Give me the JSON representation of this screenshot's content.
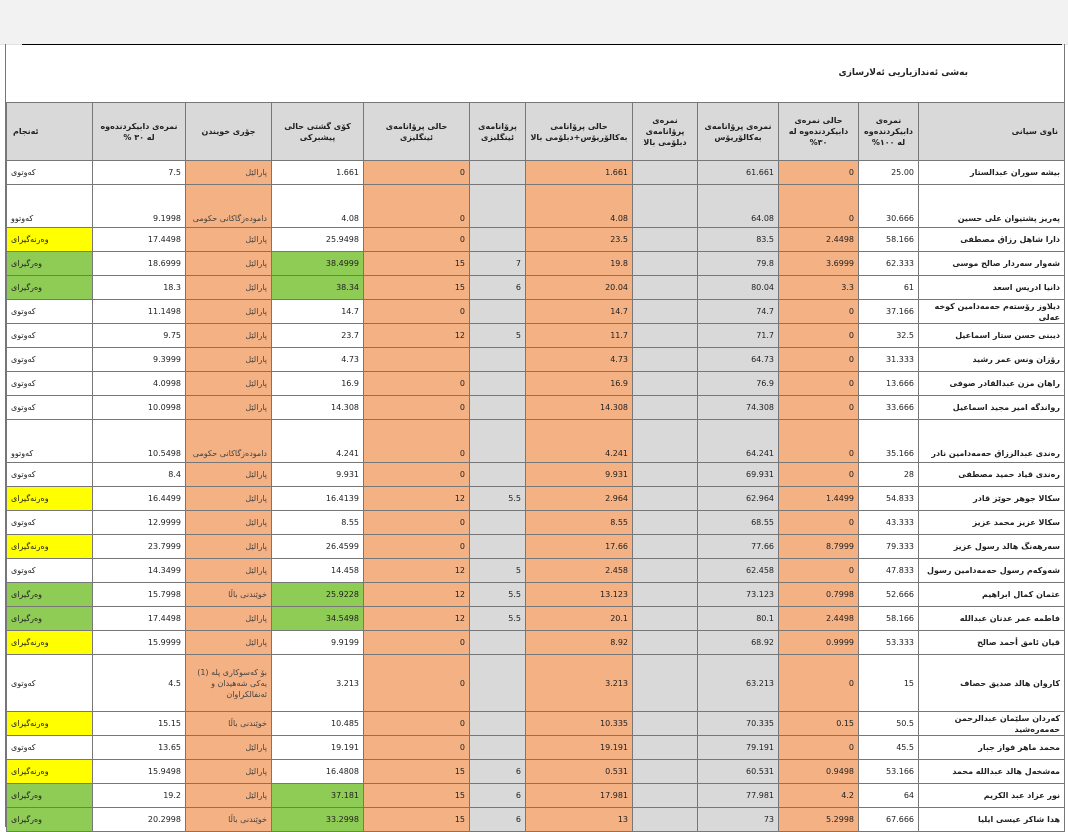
{
  "sheet": {
    "title": "بەشی ئەندازیاریی ئەلارسازی"
  },
  "table": {
    "headers": [
      "ناوی سیانی",
      "نمرەی دابیکردندەوە لە ١٠٠%",
      "حالى نمرەی دابیکردندەوە لە ٣٠%",
      "نمرەی پرۆانامەی بەکالۆریۆس",
      "نمرەی پرۆانامەی دبلۆمی بالا",
      "حالى پرۆانامى بەکالۆریۆس+دبلۆمی بالا",
      "پرۆانامەی ئینگلیزی",
      "حالى پرۆانامەی ئینگلیزی",
      "کۆی گشتی حالی پیشبرکی",
      "جۆری خویندن",
      "نمرەی دابیکردندەوە لە ٣٠ %",
      "ئەنجام"
    ],
    "rows": [
      {
        "name": "بیشە سوران عبدالستار",
        "score100": "25.00",
        "hali30": "0",
        "bach": "61.661",
        "diploma": "",
        "combined": "1.661",
        "english": "",
        "engHali": "0",
        "total": "1.661",
        "type": "پارالێل",
        "score30": "7.5",
        "result": "کەوتوی",
        "h": 23,
        "bottom": false,
        "f": {
          "hali30": "o",
          "combined": "o",
          "engHali": "o",
          "type": "o",
          "total": "",
          "result": ""
        }
      },
      {
        "name": "پەریز پشتیوان علی حسین",
        "score100": "30.666",
        "hali30": "0",
        "bach": "64.08",
        "diploma": "",
        "combined": "4.08",
        "english": "",
        "engHali": "0",
        "total": "4.08",
        "type": "دامودەزگاکانی حکومی",
        "score30": "9.1998",
        "result": "کەوتوو",
        "h": 39,
        "bottom": true,
        "f": {
          "hali30": "o",
          "combined": "o",
          "engHali": "o",
          "type": "o",
          "total": "",
          "result": ""
        }
      },
      {
        "name": "دارا شاهل رزاق مصطفی",
        "score100": "58.166",
        "hali30": "2.4498",
        "bach": "83.5",
        "diploma": "",
        "combined": "23.5",
        "english": "",
        "engHali": "0",
        "total": "25.9498",
        "type": "پارالێل",
        "score30": "17.4498",
        "result": "وەرنەگیرای",
        "h": 23,
        "bottom": false,
        "f": {
          "hali30": "o",
          "combined": "o",
          "engHali": "o",
          "type": "o",
          "total": "",
          "result": "y"
        }
      },
      {
        "name": "شەوار سەردار صالح موسی",
        "score100": "62.333",
        "hali30": "3.6999",
        "bach": "79.8",
        "diploma": "",
        "combined": "19.8",
        "english": "7",
        "engHali": "15",
        "total": "38.4999",
        "type": "پارالێل",
        "score30": "18.6999",
        "result": "وەرگیرای",
        "h": 23,
        "bottom": false,
        "f": {
          "hali30": "o",
          "combined": "o",
          "engHali": "o",
          "type": "o",
          "total": "g",
          "result": "g"
        }
      },
      {
        "name": "دانیا ادریس اسعد",
        "score100": "61",
        "hali30": "3.3",
        "bach": "80.04",
        "diploma": "",
        "combined": "20.04",
        "english": "6",
        "engHali": "15",
        "total": "38.34",
        "type": "پارالێل",
        "score30": "18.3",
        "result": "وەرگیرای",
        "h": 23,
        "bottom": false,
        "f": {
          "hali30": "o",
          "combined": "o",
          "engHali": "o",
          "type": "o",
          "total": "g",
          "result": "g"
        }
      },
      {
        "name": "دیلاوز رۆستەم حەمەدامین کوخە عەلی",
        "score100": "37.166",
        "hali30": "0",
        "bach": "74.7",
        "diploma": "",
        "combined": "14.7",
        "english": "",
        "engHali": "0",
        "total": "14.7",
        "type": "پارالێل",
        "score30": "11.1498",
        "result": "کەوتوی",
        "h": 23,
        "bottom": false,
        "f": {
          "hali30": "o",
          "combined": "o",
          "engHali": "o",
          "type": "o",
          "total": "",
          "result": ""
        }
      },
      {
        "name": "دیبنی حسن ستار اسماعیل",
        "score100": "32.5",
        "hali30": "0",
        "bach": "71.7",
        "diploma": "",
        "combined": "11.7",
        "english": "5",
        "engHali": "12",
        "total": "23.7",
        "type": "پارالێل",
        "score30": "9.75",
        "result": "کەوتوی",
        "h": 23,
        "bottom": false,
        "f": {
          "hali30": "o",
          "combined": "o",
          "engHali": "o",
          "type": "o",
          "total": "",
          "result": ""
        }
      },
      {
        "name": "رۆزان ونس عمر رشید",
        "score100": "31.333",
        "hali30": "0",
        "bach": "64.73",
        "diploma": "",
        "combined": "4.73",
        "english": "",
        "engHali": "",
        "total": "4.73",
        "type": "پارالێل",
        "score30": "9.3999",
        "result": "کەوتوی",
        "h": 23,
        "bottom": false,
        "f": {
          "hali30": "o",
          "combined": "o",
          "engHali": "o",
          "type": "o",
          "total": "",
          "result": ""
        }
      },
      {
        "name": "راهان مزن عبدالقادر صوفی",
        "score100": "13.666",
        "hali30": "0",
        "bach": "76.9",
        "diploma": "",
        "combined": "16.9",
        "english": "",
        "engHali": "0",
        "total": "16.9",
        "type": "پارالێل",
        "score30": "4.0998",
        "result": "کەوتوی",
        "h": 23,
        "bottom": false,
        "f": {
          "hali30": "o",
          "combined": "o",
          "engHali": "o",
          "type": "o",
          "total": "",
          "result": ""
        }
      },
      {
        "name": "رواندگە امیر مجید اسماعیل",
        "score100": "33.666",
        "hali30": "0",
        "bach": "74.308",
        "diploma": "",
        "combined": "14.308",
        "english": "",
        "engHali": "0",
        "total": "14.308",
        "type": "پارالێل",
        "score30": "10.0998",
        "result": "کەوتوی",
        "h": 23,
        "bottom": false,
        "f": {
          "hali30": "o",
          "combined": "o",
          "engHali": "o",
          "type": "o",
          "total": "",
          "result": ""
        }
      },
      {
        "name": "رەندی عبدالرزاق حەمەدامین نادر",
        "score100": "35.166",
        "hali30": "0",
        "bach": "64.241",
        "diploma": "",
        "combined": "4.241",
        "english": "",
        "engHali": "0",
        "total": "4.241",
        "type": "دامودەزگاکانی حکومی",
        "score30": "10.5498",
        "result": "کەوتوو",
        "h": 39,
        "bottom": true,
        "f": {
          "hali30": "o",
          "combined": "o",
          "engHali": "o",
          "type": "o",
          "total": "",
          "result": ""
        }
      },
      {
        "name": "رەندی قیاد حمید مصطفی",
        "score100": "28",
        "hali30": "0",
        "bach": "69.931",
        "diploma": "",
        "combined": "9.931",
        "english": "",
        "engHali": "0",
        "total": "9.931",
        "type": "پارالێل",
        "score30": "8.4",
        "result": "کەوتوی",
        "h": 23,
        "bottom": false,
        "f": {
          "hali30": "o",
          "combined": "o",
          "engHali": "o",
          "type": "o",
          "total": "",
          "result": ""
        }
      },
      {
        "name": "سکالا جوهر حوێز قادر",
        "score100": "54.833",
        "hali30": "1.4499",
        "bach": "62.964",
        "diploma": "",
        "combined": "2.964",
        "english": "5.5",
        "engHali": "12",
        "total": "16.4139",
        "type": "پارالێل",
        "score30": "16.4499",
        "result": "وەرنەگیرای",
        "h": 23,
        "bottom": false,
        "f": {
          "hali30": "o",
          "combined": "o",
          "engHali": "o",
          "type": "o",
          "total": "",
          "result": "y"
        }
      },
      {
        "name": "سکالا عزیز محمد عزیز",
        "score100": "43.333",
        "hali30": "0",
        "bach": "68.55",
        "diploma": "",
        "combined": "8.55",
        "english": "",
        "engHali": "0",
        "total": "8.55",
        "type": "پارالێل",
        "score30": "12.9999",
        "result": "کەوتوی",
        "h": 23,
        "bottom": false,
        "f": {
          "hali30": "o",
          "combined": "o",
          "engHali": "o",
          "type": "o",
          "total": "",
          "result": ""
        }
      },
      {
        "name": "سەرهەنگ هالد رسول عزیز",
        "score100": "79.333",
        "hali30": "8.7999",
        "bach": "77.66",
        "diploma": "",
        "combined": "17.66",
        "english": "",
        "engHali": "0",
        "total": "26.4599",
        "type": "پارالێل",
        "score30": "23.7999",
        "result": "وەرنەگیرای",
        "h": 23,
        "bottom": false,
        "f": {
          "hali30": "o",
          "combined": "o",
          "engHali": "o",
          "type": "o",
          "total": "",
          "result": "y"
        }
      },
      {
        "name": "شەوکەم رسول حەمەدامین رسول",
        "score100": "47.833",
        "hali30": "0",
        "bach": "62.458",
        "diploma": "",
        "combined": "2.458",
        "english": "5",
        "engHali": "12",
        "total": "14.458",
        "type": "پارالێل",
        "score30": "14.3499",
        "result": "کەوتوی",
        "h": 23,
        "bottom": false,
        "f": {
          "hali30": "o",
          "combined": "o",
          "engHali": "o",
          "type": "o",
          "total": "",
          "result": ""
        }
      },
      {
        "name": "عثمان کمال ابراهیم",
        "score100": "52.666",
        "hali30": "0.7998",
        "bach": "73.123",
        "diploma": "",
        "combined": "13.123",
        "english": "5.5",
        "engHali": "12",
        "total": "25.9228",
        "type": "خوێندنی باڵا",
        "score30": "15.7998",
        "result": "وەرگیرای",
        "h": 23,
        "bottom": false,
        "f": {
          "hali30": "o",
          "combined": "o",
          "engHali": "o",
          "type": "o",
          "total": "g",
          "result": "g"
        }
      },
      {
        "name": "فاطمە عمر عدنان عبداللە",
        "score100": "58.166",
        "hali30": "2.4498",
        "bach": "80.1",
        "diploma": "",
        "combined": "20.1",
        "english": "5.5",
        "engHali": "12",
        "total": "34.5498",
        "type": "پارالێل",
        "score30": "17.4498",
        "result": "وەرگیرای",
        "h": 23,
        "bottom": false,
        "f": {
          "hali30": "o",
          "combined": "o",
          "engHali": "o",
          "type": "o",
          "total": "g",
          "result": "g"
        }
      },
      {
        "name": "قیان ئامق أحمد صالح",
        "score100": "53.333",
        "hali30": "0.9999",
        "bach": "68.92",
        "diploma": "",
        "combined": "8.92",
        "english": "",
        "engHali": "0",
        "total": "9.9199",
        "type": "پارالێل",
        "score30": "15.9999",
        "result": "وەرنەگیرای",
        "h": 23,
        "bottom": false,
        "f": {
          "hali30": "o",
          "combined": "o",
          "engHali": "o",
          "type": "o",
          "total": "",
          "result": "y"
        }
      },
      {
        "name": "کاروان هالد صدیق حصاف",
        "score100": "15",
        "hali30": "0",
        "bach": "63.213",
        "diploma": "",
        "combined": "3.213",
        "english": "",
        "engHali": "0",
        "total": "3.213",
        "type": "بۆ کەسوکاری پلە (1) یەکی شەهیدان و ئەنفالکراوان",
        "score30": "4.5",
        "result": "کەوتوی",
        "h": 56,
        "bottom": false,
        "f": {
          "hali30": "o",
          "combined": "o",
          "engHali": "o",
          "type": "o",
          "total": "",
          "result": ""
        }
      },
      {
        "name": "کەردان سلێمان عبدالرحمن حەمەرەشید",
        "score100": "50.5",
        "hali30": "0.15",
        "bach": "70.335",
        "diploma": "",
        "combined": "10.335",
        "english": "",
        "engHali": "0",
        "total": "10.485",
        "type": "خوێندنی باڵا",
        "score30": "15.15",
        "result": "وەرنەگیرای",
        "h": 23,
        "bottom": false,
        "f": {
          "hali30": "o",
          "combined": "o",
          "engHali": "o",
          "type": "o",
          "total": "",
          "result": "y"
        }
      },
      {
        "name": "محمد ماهر فواز جبار",
        "score100": "45.5",
        "hali30": "0",
        "bach": "79.191",
        "diploma": "",
        "combined": "19.191",
        "english": "",
        "engHali": "0",
        "total": "19.191",
        "type": "پارالێل",
        "score30": "13.65",
        "result": "کەوتوی",
        "h": 23,
        "bottom": false,
        "f": {
          "hali30": "o",
          "combined": "o",
          "engHali": "o",
          "type": "o",
          "total": "",
          "result": ""
        }
      },
      {
        "name": "مەشخەل هالد عبداللە محمد",
        "score100": "53.166",
        "hali30": "0.9498",
        "bach": "60.531",
        "diploma": "",
        "combined": "0.531",
        "english": "6",
        "engHali": "15",
        "total": "16.4808",
        "type": "پارالێل",
        "score30": "15.9498",
        "result": "وەرنەگیرای",
        "h": 23,
        "bottom": false,
        "f": {
          "hali30": "o",
          "combined": "o",
          "engHali": "o",
          "type": "o",
          "total": "",
          "result": "y"
        }
      },
      {
        "name": "نور عزاد عبد الکریم",
        "score100": "64",
        "hali30": "4.2",
        "bach": "77.981",
        "diploma": "",
        "combined": "17.981",
        "english": "6",
        "engHali": "15",
        "total": "37.181",
        "type": "پارالێل",
        "score30": "19.2",
        "result": "وەرگیرای",
        "h": 23,
        "bottom": false,
        "f": {
          "hali30": "o",
          "combined": "o",
          "engHali": "o",
          "type": "o",
          "total": "g",
          "result": "g"
        }
      },
      {
        "name": "هدا شاکر عیسی ایلیا",
        "score100": "67.666",
        "hali30": "5.2998",
        "bach": "73",
        "diploma": "",
        "combined": "13",
        "english": "6",
        "engHali": "15",
        "total": "33.2998",
        "type": "خوێندنی باڵا",
        "score30": "20.2998",
        "result": "وەرگیرای",
        "h": 23,
        "bottom": false,
        "f": {
          "hali30": "o",
          "combined": "o",
          "engHali": "o",
          "type": "o",
          "total": "g",
          "result": "g"
        }
      }
    ]
  },
  "colors": {
    "header_bg": "#d9d9d9",
    "orange": "#f4b183",
    "green": "#8fcc55",
    "yellow": "#ffff00"
  }
}
